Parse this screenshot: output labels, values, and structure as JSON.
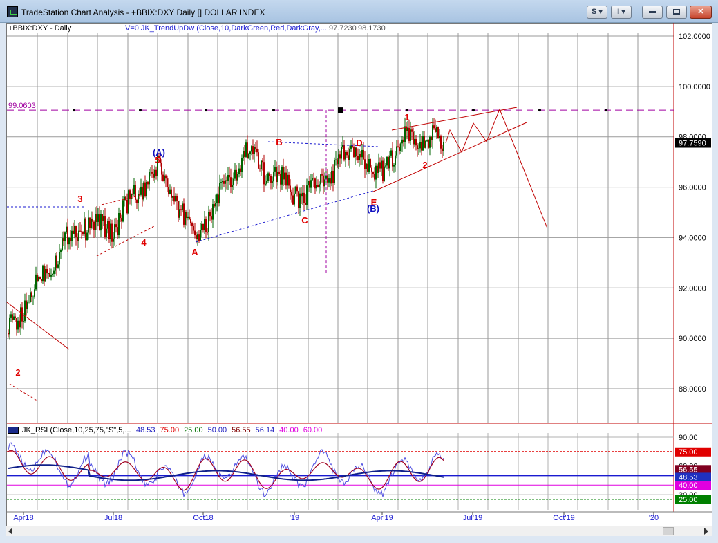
{
  "window": {
    "title": "TradeStation Chart Analysis - +BBIX:DXY Daily [] DOLLAR INDEX",
    "btn_s": "S",
    "btn_i": "I"
  },
  "chart": {
    "symbol": "+BBIX:DXY - Daily",
    "indicator_header": "V=0  JK_TrendUpDw  (Close,10,DarkGreen,Red,DarkGray,...",
    "indicator_v1": "97.7230",
    "indicator_v2": "98.1730",
    "last_price": "97.7590",
    "hline_label": "99.0603",
    "hline_value": 99.0603
  },
  "rsi": {
    "header": "JK_RSI  (Close,10,25,75,\"S\",5,...",
    "values": [
      {
        "text": "48.53",
        "color": "#2020c0"
      },
      {
        "text": "75.00",
        "color": "#e00000"
      },
      {
        "text": "25.00",
        "color": "#007000"
      },
      {
        "text": "50.00",
        "color": "#2020c0"
      },
      {
        "text": "56.55",
        "color": "#800000"
      },
      {
        "text": "56.14",
        "color": "#2020c0"
      },
      {
        "text": "40.00",
        "color": "#e000e0"
      },
      {
        "text": "60.00",
        "color": "#e000e0"
      }
    ],
    "axis_labels": [
      "90.00",
      "60.00",
      "30.00"
    ],
    "badges": [
      {
        "text": "75.00",
        "bg": "#e00000",
        "fg": "#ffffff",
        "value": 75
      },
      {
        "text": "56.55",
        "bg": "#800020",
        "fg": "#ffffff",
        "value": 56.55
      },
      {
        "text": "48.53",
        "bg": "#2030c0",
        "fg": "#ffffff",
        "value": 48.53
      },
      {
        "text": "40.00",
        "bg": "#e000e0",
        "fg": "#ffffff",
        "value": 40
      },
      {
        "text": "25.00",
        "bg": "#008000",
        "fg": "#ffffff",
        "value": 25
      }
    ]
  },
  "chart_data": {
    "type": "candlestick",
    "y_ticks": [
      "102.0000",
      "100.0000",
      "98.0000",
      "96.0000",
      "94.0000",
      "92.0000",
      "90.0000",
      "88.0000"
    ],
    "ylim": [
      86.6,
      102.4
    ],
    "x_ticks": [
      "Apr18",
      "Jul18",
      "Oct18",
      "'19",
      "Apr'19",
      "Jul'19",
      "Oct'19",
      "'20"
    ],
    "anchor_closes": [
      {
        "date": "Apr18",
        "close": 90.2
      },
      {
        "date": "May18",
        "close": 93.3
      },
      {
        "date": "Jun18",
        "close": 94.6
      },
      {
        "date": "Jul18",
        "close": 94.3
      },
      {
        "date": "Aug18",
        "close": 96.7
      },
      {
        "date": "Oct18",
        "close": 94.0
      },
      {
        "date": "Nov18",
        "close": 97.3
      },
      {
        "date": "Jan'19",
        "close": 95.6
      },
      {
        "date": "Mar'19",
        "close": 97.6
      },
      {
        "date": "Apr'19",
        "close": 96.4
      },
      {
        "date": "May'19",
        "close": 98.0
      },
      {
        "date": "Jun'19",
        "close": 97.7
      }
    ],
    "wave_labels": [
      {
        "text": "2",
        "color": "#e00000"
      },
      {
        "text": "3",
        "color": "#e00000"
      },
      {
        "text": "4",
        "color": "#e00000"
      },
      {
        "text": "(A)",
        "color": "#1010c0"
      },
      {
        "text": "5",
        "color": "#e00000"
      },
      {
        "text": "A",
        "color": "#e00000"
      },
      {
        "text": "B",
        "color": "#e00000"
      },
      {
        "text": "C",
        "color": "#e00000"
      },
      {
        "text": "D",
        "color": "#e00000"
      },
      {
        "text": "E",
        "color": "#e00000"
      },
      {
        "text": "(B)",
        "color": "#1010c0"
      },
      {
        "text": "1",
        "color": "#e00000"
      },
      {
        "text": "2",
        "color": "#e00000"
      }
    ]
  }
}
